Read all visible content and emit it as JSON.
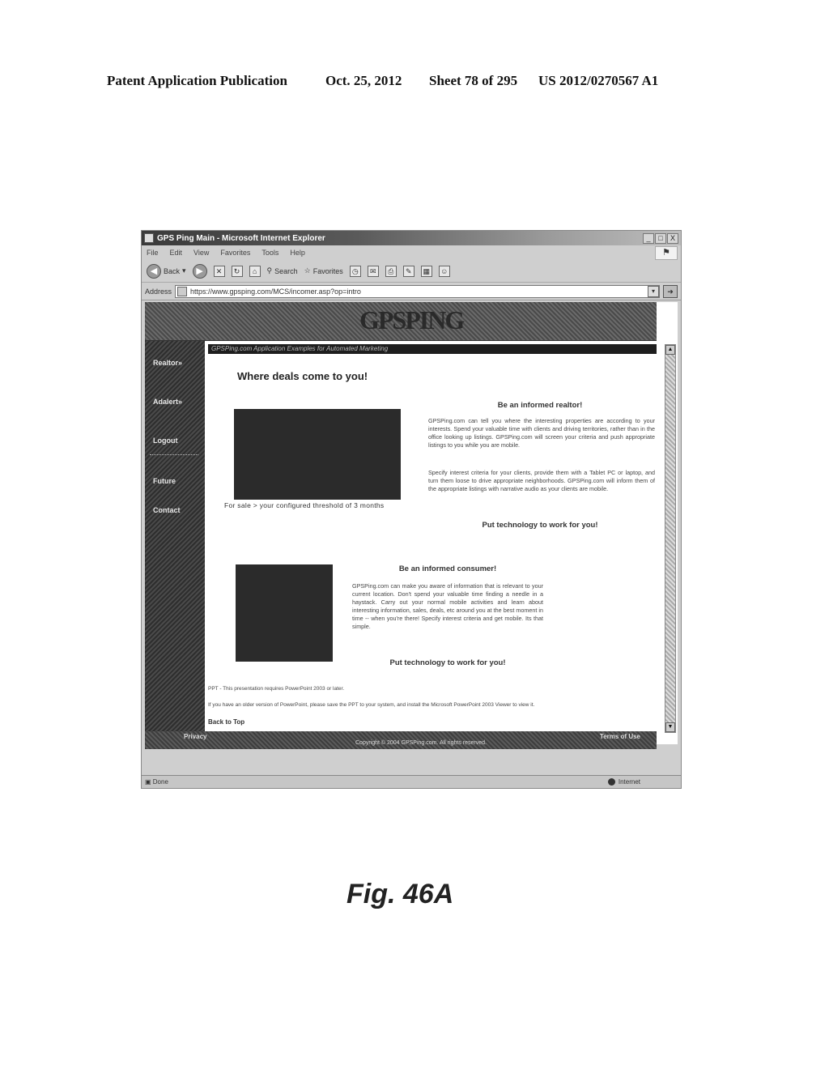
{
  "publication": {
    "label": "Patent Application Publication",
    "date": "Oct. 25, 2012",
    "sheet": "Sheet 78 of 295",
    "number": "US 2012/0270567 A1"
  },
  "browser": {
    "window_title": "GPS Ping Main - Microsoft Internet Explorer",
    "window_buttons": [
      "_",
      "□",
      "X"
    ],
    "menu": [
      "File",
      "Edit",
      "View",
      "Favorites",
      "Tools",
      "Help"
    ],
    "toolbar": {
      "back": "Back",
      "search": "Search",
      "favorites": "Favorites"
    },
    "address_label": "Address",
    "address_value": "https://www.gpsping.com/MCS/incomer.asp?op=intro",
    "go_label": "Go",
    "status_text": "Done",
    "status_zone": "Internet"
  },
  "site": {
    "logo": "GPSPING",
    "strip_text": "GPSPing.com Application Examples for Automated Marketing",
    "sidebar": [
      {
        "label": "Realtor»"
      },
      {
        "label": "Adalert»"
      },
      {
        "label": "Logout"
      },
      {
        "label": "Future"
      },
      {
        "label": "Contact"
      }
    ],
    "headline": "Where deals come to you!",
    "image1_caption": "For sale > your configured threshold of 3 months",
    "realtor": {
      "title": "Be an informed realtor!",
      "para1": "GPSPing.com can tell you where the interesting properties are according to your interests. Spend your valuable time with clients and driving territories, rather than in the office looking up listings. GPSPing.com will screen your criteria and push appropriate listings to you while you are mobile.",
      "para2": "Specify interest criteria for your clients, provide them with a Tablet PC or laptop, and turn them loose to drive appropriate neighborhoods. GPSPing.com will inform them of the appropriate listings with narrative audio as your clients are mobile.",
      "cta": "Put technology to work for you!"
    },
    "consumer": {
      "title": "Be an informed consumer!",
      "para": "GPSPing.com can make you aware of information that is relevant to your current location. Don't spend your valuable time finding a needle in a haystack. Carry out your normal mobile activities and learn about interesting information, sales, deals, etc around you at the best moment in time -- when you're there! Specify interest criteria and get mobile. Its that simple.",
      "cta": "Put technology to work for you!"
    },
    "note1": "PPT - This presentation requires PowerPoint 2003 or later.",
    "note2": "If you have an older version of PowerPoint, please save the PPT to your system, and install the Microsoft PowerPoint 2003 Viewer to view it.",
    "back_to_top": "Back to Top",
    "footer": {
      "privacy": "Privacy",
      "terms": "Terms of Use",
      "copyright": "Copyright © 2004 GPSPing.com. All rights reserved."
    }
  },
  "figure_caption": "Fig. 46A"
}
